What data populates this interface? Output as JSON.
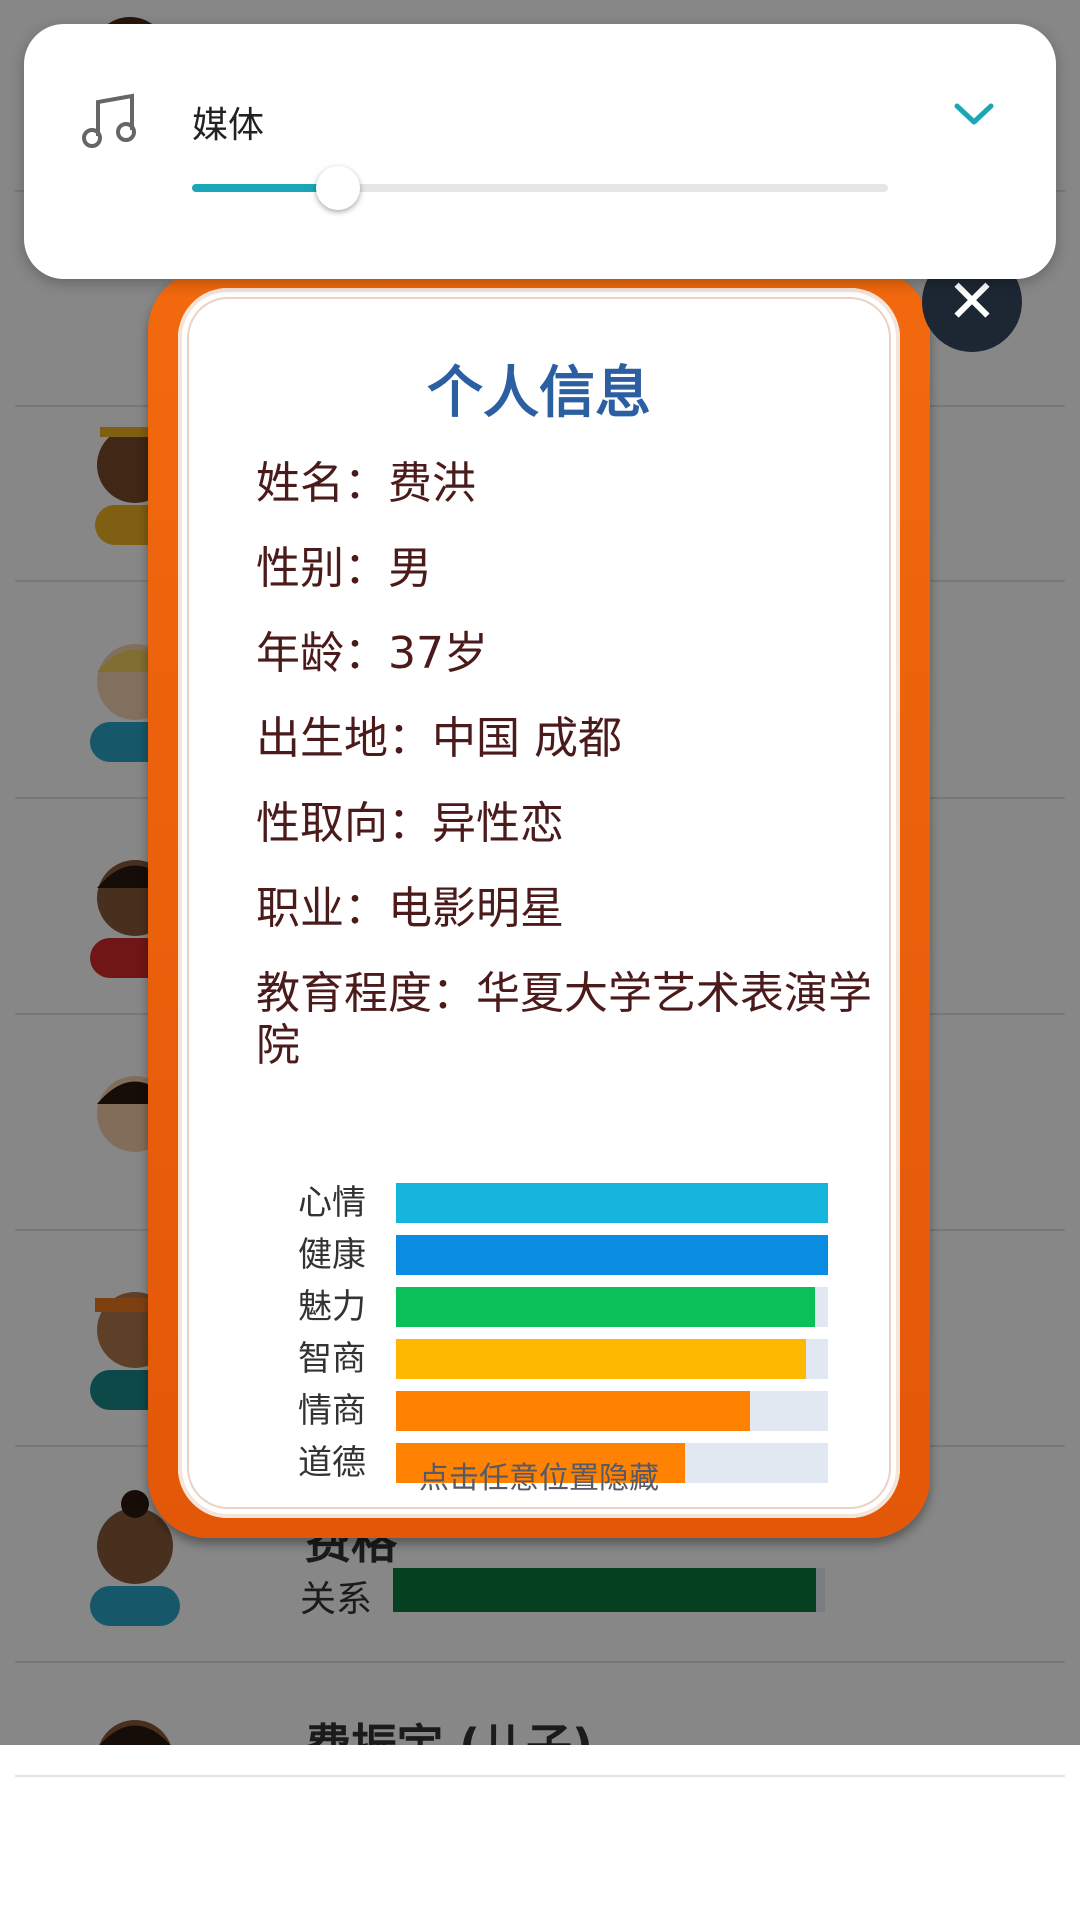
{
  "volume_panel": {
    "label": "媒体",
    "icon": "music-note-icon",
    "level": 0.21,
    "accent_color": "#1ba6b8"
  },
  "background": {
    "members": [
      {
        "name": "",
        "relation_label": ""
      },
      {
        "name": "",
        "relation_label": ""
      },
      {
        "name": "",
        "relation_label": ""
      },
      {
        "name": "",
        "relation_label": ""
      },
      {
        "name": "",
        "relation_label": ""
      },
      {
        "name": "",
        "relation_label": ""
      },
      {
        "name": "费格",
        "relation_label": "关系",
        "relation_level": 0.98
      },
      {
        "name": "费振宇 (儿子)",
        "relation_label": ""
      }
    ]
  },
  "info_card": {
    "title": "个人信息",
    "lines": [
      "姓名：费洪",
      "性别：男",
      "年龄：37岁",
      "出生地：中国 成都",
      "性取向：异性恋",
      "职业：电影明星",
      "教育程度：华夏大学艺术表演学院"
    ],
    "stats": [
      {
        "label": "心情",
        "value": 1.0,
        "color": "#16b5de"
      },
      {
        "label": "健康",
        "value": 1.0,
        "color": "#0a8ce3"
      },
      {
        "label": "魅力",
        "value": 0.97,
        "color": "#0bbf59"
      },
      {
        "label": "智商",
        "value": 0.95,
        "color": "#ffb800"
      },
      {
        "label": "情商",
        "value": 0.82,
        "color": "#ff8203"
      },
      {
        "label": "道德",
        "value": 0.67,
        "color": "#ff8203"
      }
    ],
    "hint": "点击任意位置隐藏",
    "close_icon": "close-icon"
  }
}
